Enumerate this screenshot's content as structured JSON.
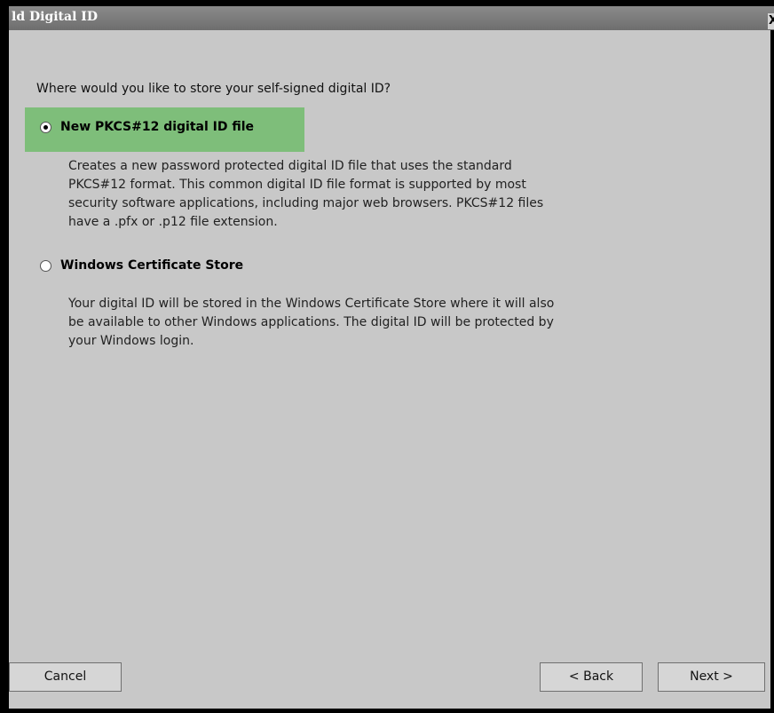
{
  "window": {
    "title": "ld Digital ID",
    "close_label": "X"
  },
  "question": "Where would you like to store your self-signed digital ID?",
  "options": [
    {
      "label": "New PKCS#12 digital ID file",
      "selected": true,
      "description": "Creates a new password protected digital ID file that uses the standard PKCS#12 format. This common digital ID file format is supported by most security software applications, including major web browsers. PKCS#12 files have a .pfx or .p12 file extension."
    },
    {
      "label": "Windows Certificate Store",
      "selected": false,
      "description": "Your digital ID will be stored in the Windows Certificate Store where it will also be available to other Windows applications. The digital ID will be protected by your Windows login."
    }
  ],
  "buttons": {
    "cancel": "Cancel",
    "back": "< Back",
    "next": "Next >"
  },
  "colors": {
    "highlight": "#7ebe7a",
    "dialog_bg": "#c8c8c8"
  }
}
